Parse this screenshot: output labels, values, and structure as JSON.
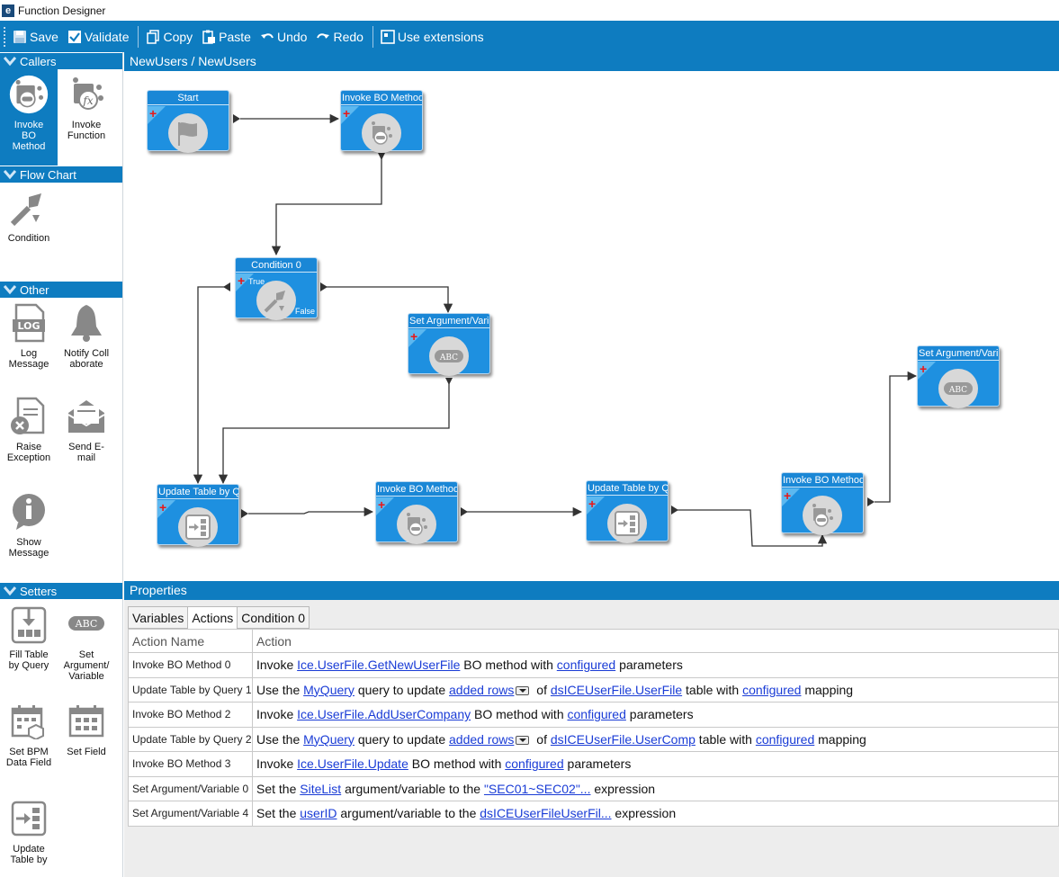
{
  "window": {
    "title": "Function Designer",
    "logo": "e"
  },
  "toolbar": {
    "save": "Save",
    "validate": "Validate",
    "copy": "Copy",
    "paste": "Paste",
    "undo": "Undo",
    "redo": "Redo",
    "use_extensions": "Use extensions"
  },
  "palette": {
    "callers": {
      "title": "Callers",
      "invoke_bo": "Invoke BO Method",
      "invoke_function": "Invoke Function"
    },
    "flow_chart": {
      "title": "Flow Chart",
      "condition": "Condition"
    },
    "other": {
      "title": "Other",
      "log_message": "Log Message",
      "notify": "Notify Collaborate",
      "raise_exception": "Raise Exception",
      "send_email": "Send E-mail",
      "show_message": "Show Message",
      "log_icon_text": "LOG"
    },
    "setters": {
      "title": "Setters",
      "fill_table": "Fill Table by Query",
      "set_argument": "Set Argument/ Variable",
      "set_bpm": "Set BPM Data Field",
      "set_field": "Set Field",
      "update_table": "Update Table by",
      "abc_icon_text": "ABC"
    }
  },
  "canvas": {
    "breadcrumb": "NewUsers / NewUsers",
    "nodes": {
      "start": "Start",
      "invoke0": "Invoke BO Method",
      "condition0": "Condition 0",
      "cond_true": "True",
      "cond_false": "False",
      "setarg0": "Set Argument/Vari",
      "update1": "Update Table by Q",
      "invoke2": "Invoke BO Method",
      "update2": "Update Table by Q",
      "invoke3": "Invoke BO Method",
      "setarg4": "Set Argument/Vari",
      "abc": "ABC"
    }
  },
  "properties": {
    "title": "Properties",
    "tabs": [
      "Variables",
      "Actions",
      "Condition 0"
    ],
    "active_tab": "Actions",
    "headers": {
      "name": "Action Name",
      "action": "Action"
    },
    "rows": [
      {
        "name": "Invoke BO Method 0",
        "t1": "Invoke ",
        "l1": "Ice.UserFile.GetNewUserFile",
        "t2": " BO method with ",
        "l2": "configured",
        "t3": " parameters"
      },
      {
        "name": "Update Table by Query 1",
        "t1": "Use the ",
        "l1": "MyQuery",
        "t2": " query to update ",
        "l2": "added rows",
        "t3": " of ",
        "l3": "dsICEUserFile.UserFile",
        "t4": " table with ",
        "l4": "configured",
        "t5": " mapping"
      },
      {
        "name": "Invoke BO Method 2",
        "t1": "Invoke ",
        "l1": "Ice.UserFile.AddUserCompany",
        "t2": " BO method with ",
        "l2": "configured",
        "t3": " parameters"
      },
      {
        "name": "Update Table by Query 2",
        "t1": "Use the ",
        "l1": "MyQuery",
        "t2": " query to update ",
        "l2": "added rows",
        "t3": " of ",
        "l3": "dsICEUserFile.UserComp",
        "t4": " table with ",
        "l4": "configured",
        "t5": " mapping"
      },
      {
        "name": "Invoke BO Method 3",
        "t1": "Invoke ",
        "l1": "Ice.UserFile.Update",
        "t2": " BO method with ",
        "l2": "configured",
        "t3": " parameters"
      },
      {
        "name": "Set Argument/Variable 0",
        "t1": "Set the ",
        "l1": "SiteList",
        "t2": " argument/variable to the ",
        "l2": "\"SEC01~SEC02\"...",
        "t3": " expression"
      },
      {
        "name": "Set Argument/Variable 4",
        "t1": "Set the ",
        "l1": "userID",
        "t2": " argument/variable to the ",
        "l2": "dsICEUserFileUserFil...",
        "t3": " expression"
      }
    ]
  }
}
